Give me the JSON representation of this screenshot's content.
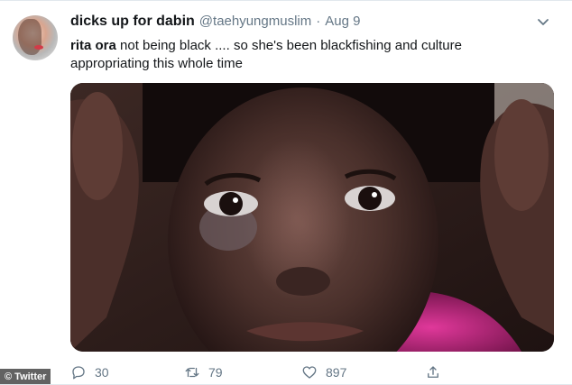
{
  "tweet": {
    "display_name": "dicks up for dabin",
    "handle": "@taehyungmuslim",
    "separator": "·",
    "date": "Aug 9",
    "text_mention": "rita ora",
    "text_line1_rest": " not being black .... so she's been blackfishing and culture",
    "text_line2": "appropriating this whole time"
  },
  "icons": {
    "menu": "chevron-down-icon",
    "reply": "reply-icon",
    "retweet": "retweet-icon",
    "like": "heart-icon",
    "share": "share-icon"
  },
  "actions": {
    "reply_count": "30",
    "retweet_count": "79",
    "like_count": "897"
  },
  "watermark": "© Twitter",
  "colors": {
    "text_primary": "#14171a",
    "text_secondary": "#657786",
    "border": "#e1e8ed"
  }
}
